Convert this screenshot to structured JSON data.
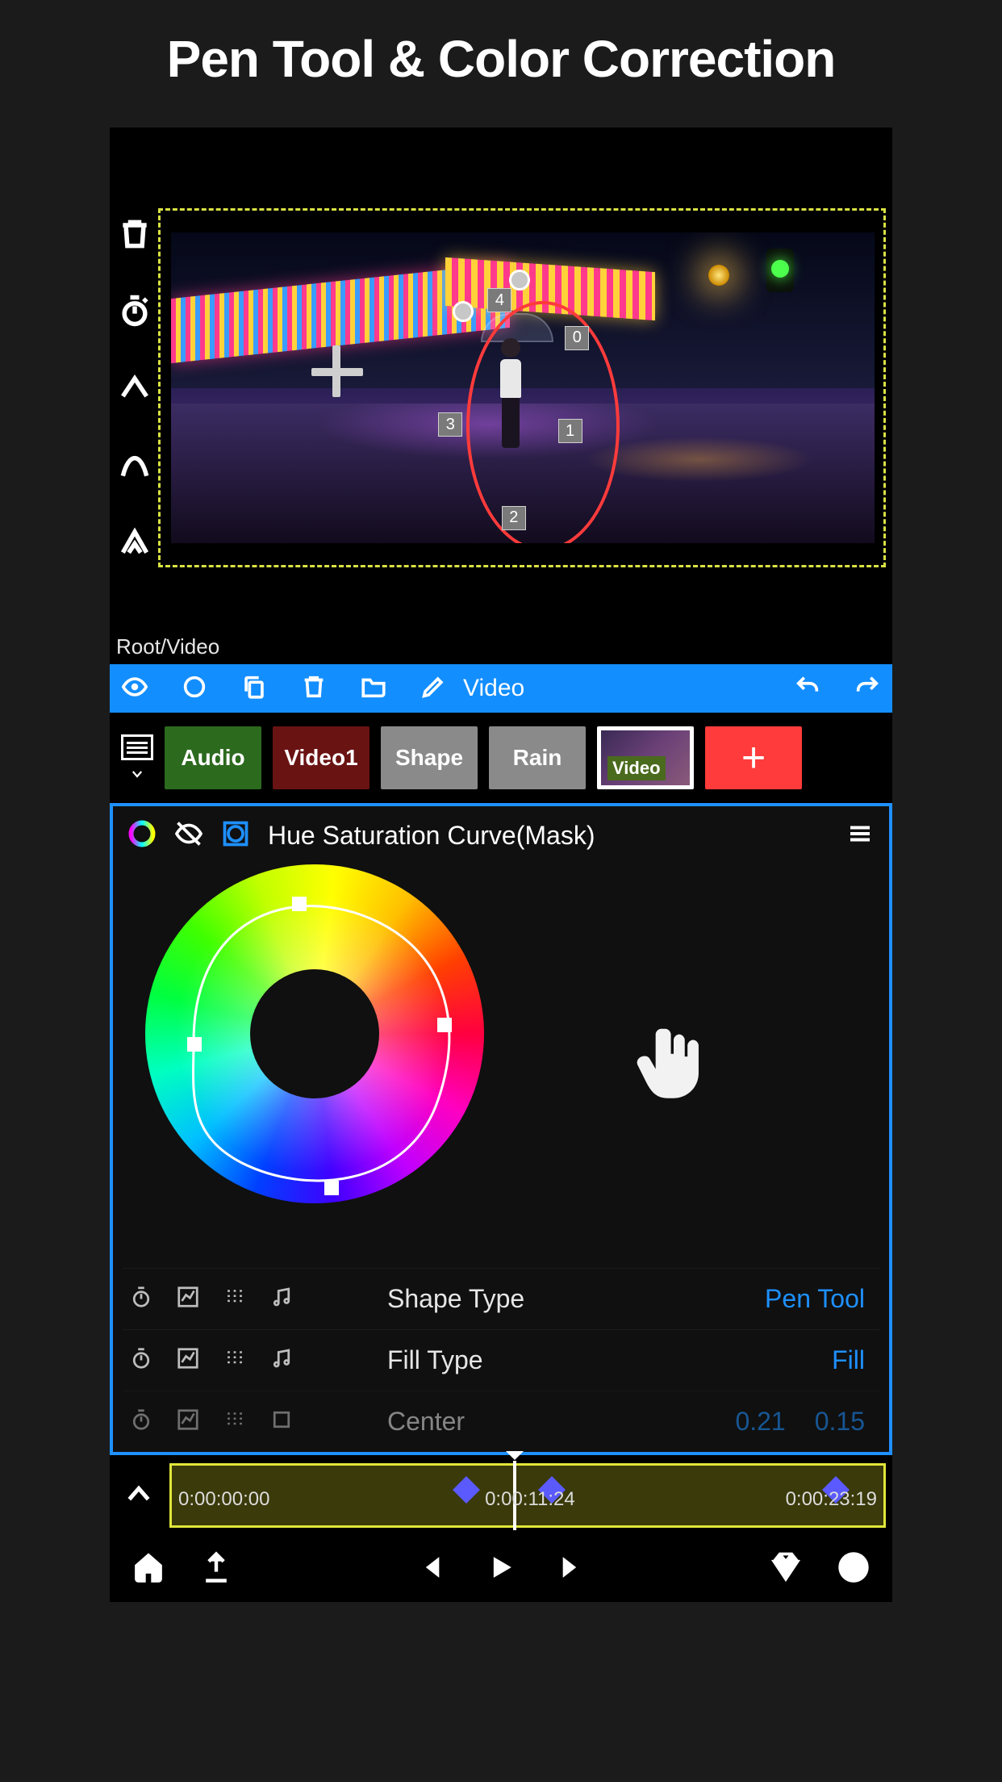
{
  "page_title": "Pen Tool & Color Correction",
  "breadcrumb": "Root/Video",
  "blue_toolbar": {
    "rename_label": "Video"
  },
  "layers": {
    "items": [
      {
        "label": "Audio"
      },
      {
        "label": "Video1"
      },
      {
        "label": "Shape"
      },
      {
        "label": "Rain"
      },
      {
        "label": "Video"
      }
    ],
    "add_label": "+"
  },
  "pen_points": {
    "labels": [
      "0",
      "1",
      "2",
      "3",
      "4"
    ]
  },
  "hue_panel": {
    "title": "Hue Saturation Curve(Mask)"
  },
  "properties": [
    {
      "label": "Shape Type",
      "value": "Pen Tool"
    },
    {
      "label": "Fill Type",
      "value": "Fill"
    },
    {
      "label": "Center",
      "value_a": "0.21",
      "value_b": "0.15"
    }
  ],
  "timeline": {
    "start": "0:00:00:00",
    "current": "0:00:11:24",
    "end": "0:00:23:19"
  }
}
